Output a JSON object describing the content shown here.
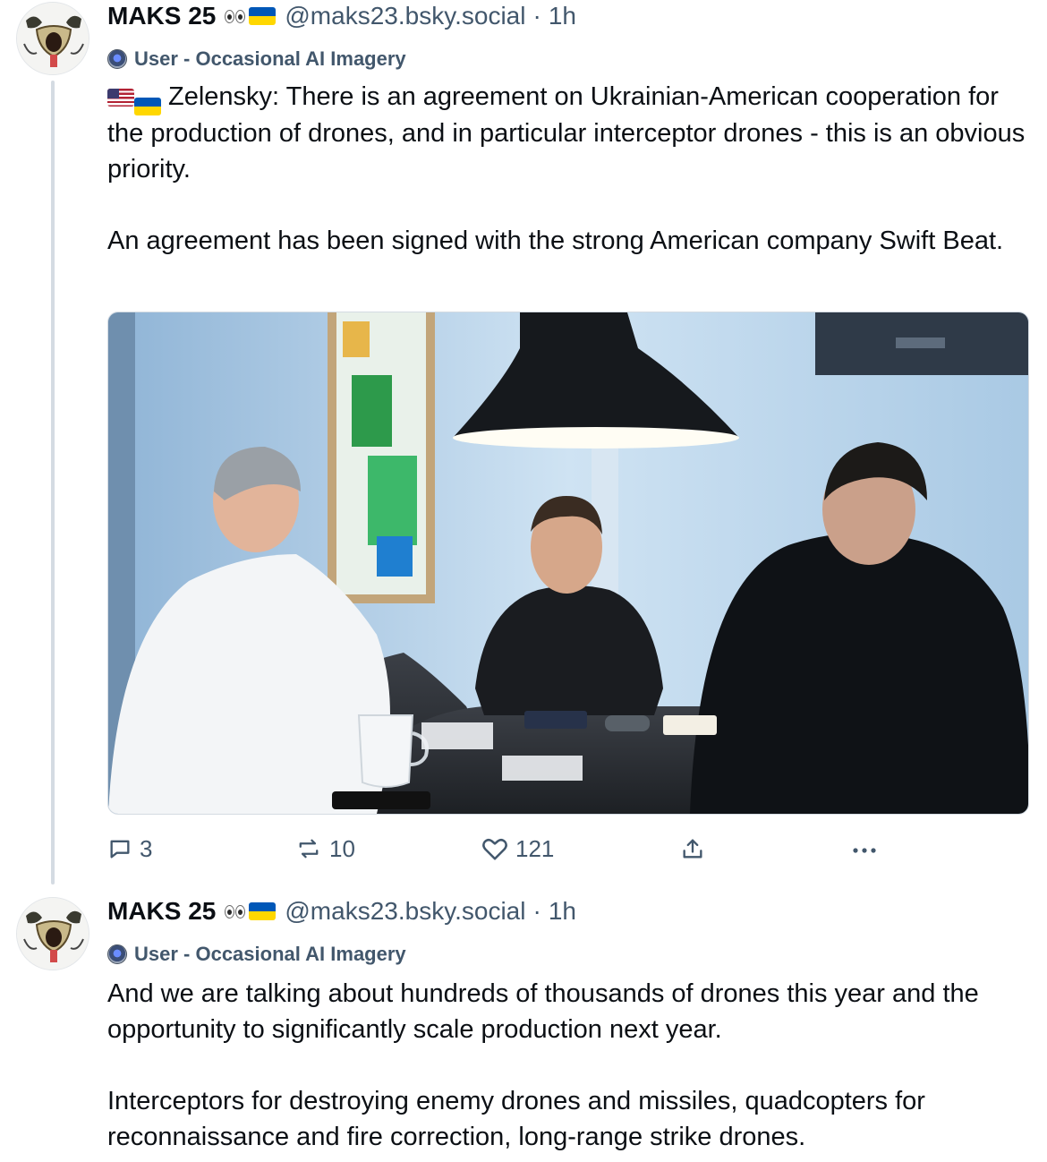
{
  "posts": [
    {
      "author": {
        "display_name": "MAKS 25",
        "handle": "@maks23.bsky.social",
        "separator": "·",
        "time": "1h",
        "emoji_icons": [
          "eyes-icon",
          "ukraine-flag-icon"
        ]
      },
      "label": "User - Occasional AI Imagery",
      "text": {
        "paragraph_1": "Zelensky: There is an agreement on Ukrainian-American cooperation for the production of drones, and in particular interceptor drones - this is an obvious priority.",
        "paragraph_2": "An agreement has been signed with the strong American company Swift Beat."
      },
      "counts": {
        "replies": "3",
        "reposts": "10",
        "likes": "121"
      }
    },
    {
      "author": {
        "display_name": "MAKS 25",
        "handle": "@maks23.bsky.social",
        "separator": "·",
        "time": "1h",
        "emoji_icons": [
          "eyes-icon",
          "ukraine-flag-icon"
        ]
      },
      "label": "User - Occasional AI Imagery",
      "text": {
        "paragraph_1": "And we are talking about hundreds of thousands of drones this year and the opportunity to significantly scale production next year.",
        "paragraph_2": "Interceptors for destroying enemy drones and missiles, quadcopters for reconnaissance and fire correction, long-range strike drones."
      }
    }
  ],
  "colors": {
    "text_primary": "#0b0f14",
    "text_secondary": "#42576c",
    "thread_line": "#d4dbe2",
    "ukraine_blue": "#0057b7",
    "ukraine_yellow": "#ffd700"
  }
}
